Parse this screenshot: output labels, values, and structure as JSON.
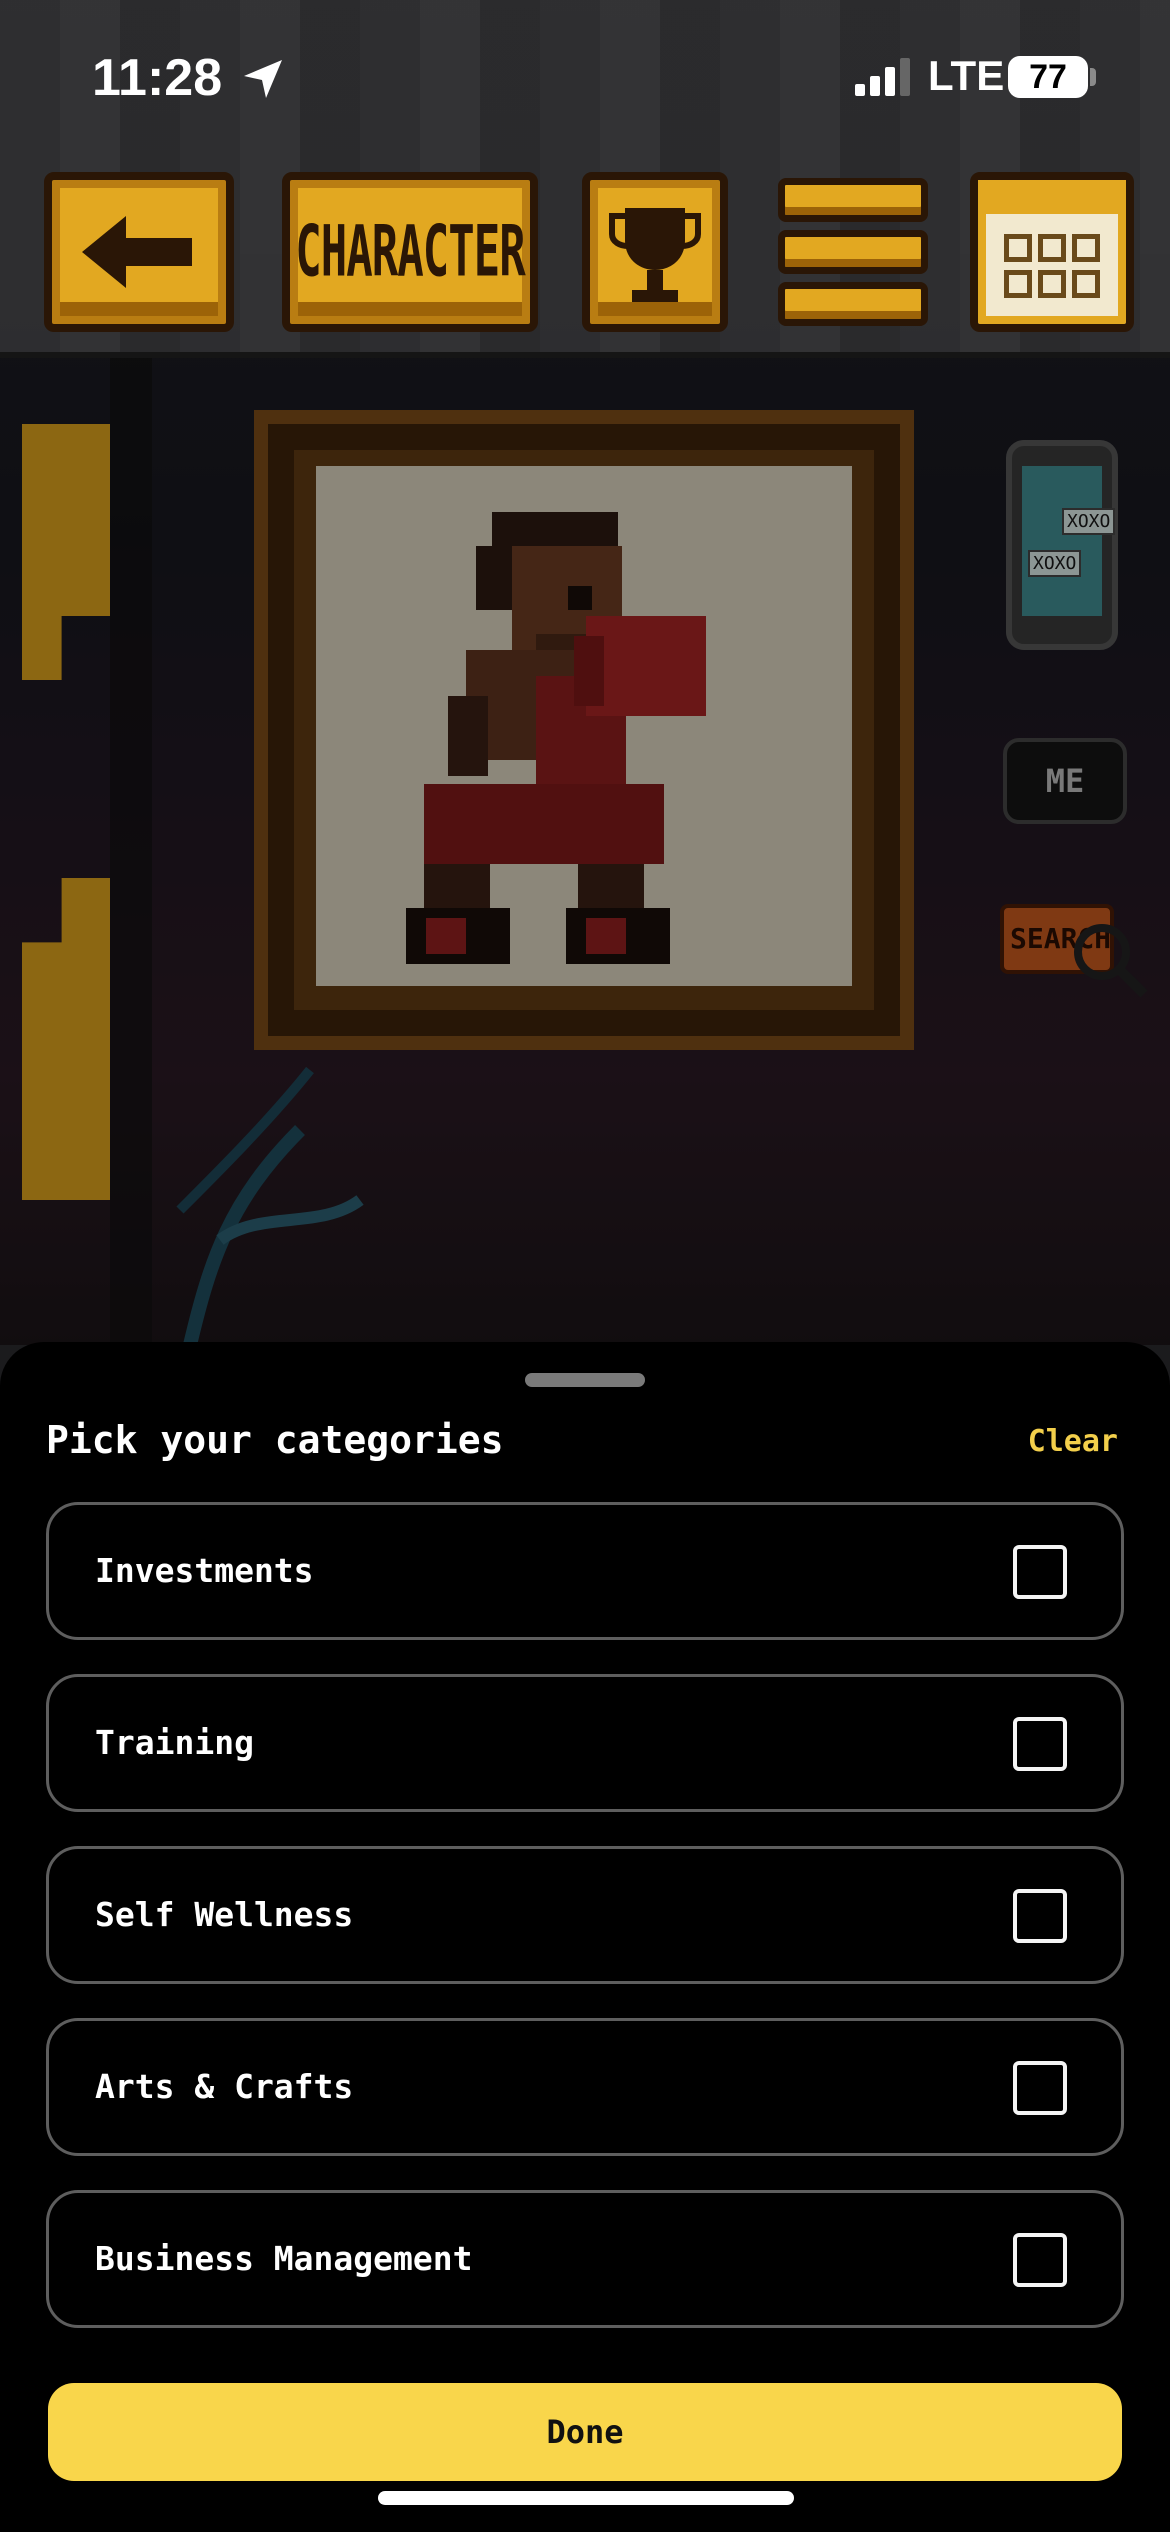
{
  "status_bar": {
    "time": "11:28",
    "network": "LTE",
    "battery": "77"
  },
  "toolbar": {
    "character_label": "CHARACTER"
  },
  "hud": {
    "phone_text_1": "XOXO",
    "phone_text_2": "XOXO",
    "me_label": "ME",
    "search_label": "SEARCH"
  },
  "sheet": {
    "title": "Pick your categories",
    "clear_label": "Clear",
    "categories": [
      {
        "label": "Investments",
        "checked": false
      },
      {
        "label": "Training",
        "checked": false
      },
      {
        "label": "Self Wellness",
        "checked": false
      },
      {
        "label": "Arts & Crafts",
        "checked": false
      },
      {
        "label": "Business Management",
        "checked": false
      }
    ],
    "done_label": "Done"
  },
  "colors": {
    "accent": "#f9d64b",
    "clear_text": "#f3cf4b",
    "sheet_bg": "#000000",
    "button_gold": "#e2a821"
  }
}
